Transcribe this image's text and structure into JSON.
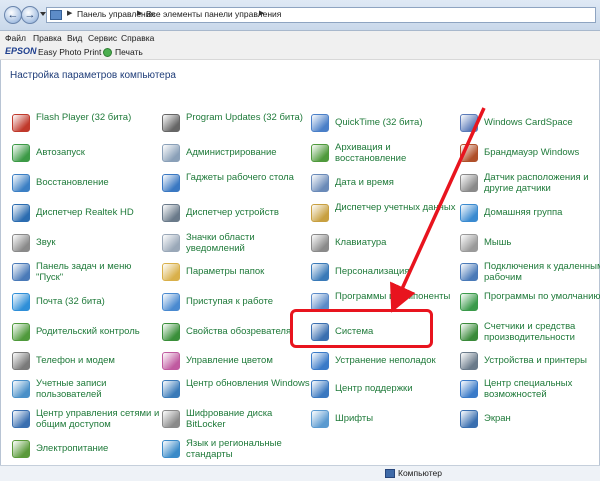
{
  "breadcrumb": [
    "Панель управления",
    "Все элементы панели управления"
  ],
  "menu": [
    "Файл",
    "Правка",
    "Вид",
    "Сервис",
    "Справка"
  ],
  "toolbar": {
    "brand": "EPSON",
    "photo_print": "Easy Photo Print",
    "print": "Печать"
  },
  "heading": "Настройка параметров компьютера",
  "columns": [
    [
      {
        "label": "Flash Player (32 бита)",
        "icon": "flash-icon",
        "color": "#c0392b"
      },
      {
        "label": "Автозапуск",
        "icon": "autoplay-icon",
        "color": "#3c9a46"
      },
      {
        "label": "Восстановление",
        "icon": "recovery-icon",
        "color": "#3b7fc4"
      },
      {
        "label": "Диспетчер Realtek HD",
        "icon": "realtek-icon",
        "color": "#2b6cb0"
      },
      {
        "label": "Звук",
        "icon": "sound-icon",
        "color": "#8a8a8a"
      },
      {
        "label": "Панель задач и меню \"Пуск\"",
        "icon": "taskbar-icon",
        "color": "#4a7ab8"
      },
      {
        "label": "Почта (32 бита)",
        "icon": "mail-icon",
        "color": "#2f8fd8"
      },
      {
        "label": "Родительский контроль",
        "icon": "parental-icon",
        "color": "#4f9a3c"
      },
      {
        "label": "Телефон и модем",
        "icon": "phone-icon",
        "color": "#7a7a7a"
      },
      {
        "label": "Учетные записи пользователей",
        "icon": "users-icon",
        "color": "#4a90c8"
      },
      {
        "label": "Центр управления сетями и общим доступом",
        "icon": "network-icon",
        "color": "#3a6fb0"
      },
      {
        "label": "Электропитание",
        "icon": "power-icon",
        "color": "#5a9a3a"
      }
    ],
    [
      {
        "label": "Program Updates (32 бита)",
        "icon": "updates-icon",
        "color": "#666666"
      },
      {
        "label": "Администрирование",
        "icon": "admin-icon",
        "color": "#8aa0b8"
      },
      {
        "label": "Гаджеты рабочего стола",
        "icon": "gadgets-icon",
        "color": "#3a78c2"
      },
      {
        "label": "Диспетчер устройств",
        "icon": "devmgr-icon",
        "color": "#6a7a8a"
      },
      {
        "label": "Значки области уведомлений",
        "icon": "tray-icon",
        "color": "#9aa8b8"
      },
      {
        "label": "Параметры папок",
        "icon": "folder-options-icon",
        "color": "#d9b04a"
      },
      {
        "label": "Приступая к работе",
        "icon": "getting-started-icon",
        "color": "#4a8ad0"
      },
      {
        "label": "Свойства обозревателя",
        "icon": "ie-icon",
        "color": "#3a8f3a"
      },
      {
        "label": "Управление цветом",
        "icon": "color-icon",
        "color": "#c05aa0"
      },
      {
        "label": "Центр обновления Windows",
        "icon": "windows-update-icon",
        "color": "#3a7ab8"
      },
      {
        "label": "Шифрование диска BitLocker",
        "icon": "bitlocker-icon",
        "color": "#8a8a8a"
      },
      {
        "label": "Язык и региональные стандарты",
        "icon": "region-icon",
        "color": "#3a8ac8"
      }
    ],
    [
      {
        "label": "QuickTime (32 бита)",
        "icon": "quicktime-icon",
        "color": "#4a7fc8"
      },
      {
        "label": "Архивация и восстановление",
        "icon": "backup-icon",
        "color": "#4f9a3c"
      },
      {
        "label": "Дата и время",
        "icon": "datetime-icon",
        "color": "#6a8ab8"
      },
      {
        "label": "Диспетчер учетных данных",
        "icon": "credentials-icon",
        "color": "#c8a040"
      },
      {
        "label": "Клавиатура",
        "icon": "keyboard-icon",
        "color": "#8a8a8a"
      },
      {
        "label": "Персонализация",
        "icon": "personalization-icon",
        "color": "#3a7ab8"
      },
      {
        "label": "Программы и компоненты",
        "icon": "programs-icon",
        "color": "#5a8ac8"
      },
      {
        "label": "Система",
        "icon": "system-icon",
        "color": "#3a6fb0"
      },
      {
        "label": "Устранение неполадок",
        "icon": "troubleshoot-icon",
        "color": "#3a7ac8"
      },
      {
        "label": "Центр поддержки",
        "icon": "action-center-icon",
        "color": "#3a78c0"
      },
      {
        "label": "Шрифты",
        "icon": "fonts-icon",
        "color": "#5a9ad0"
      }
    ],
    [
      {
        "label": "Windows CardSpace",
        "icon": "cardspace-icon",
        "color": "#5a7ab8"
      },
      {
        "label": "Брандмауэр Windows",
        "icon": "firewall-icon",
        "color": "#b0502a"
      },
      {
        "label": "Датчик расположения и другие датчики",
        "icon": "sensor-icon",
        "color": "#8a8a8a"
      },
      {
        "label": "Домашняя группа",
        "icon": "homegroup-icon",
        "color": "#3a8ad0"
      },
      {
        "label": "Мышь",
        "icon": "mouse-icon",
        "color": "#9a9a9a"
      },
      {
        "label": "Подключения к удаленным рабочим",
        "icon": "remote-icon",
        "color": "#4a7ab8"
      },
      {
        "label": "Программы по умолчанию",
        "icon": "default-programs-icon",
        "color": "#3a9a4a"
      },
      {
        "label": "Счетчики и средства производительности",
        "icon": "performance-icon",
        "color": "#3a8a3a"
      },
      {
        "label": "Устройства и принтеры",
        "icon": "printers-icon",
        "color": "#6a7a8a"
      },
      {
        "label": "Центр специальных возможностей",
        "icon": "accessibility-icon",
        "color": "#3a7ac8"
      },
      {
        "label": "Экран",
        "icon": "display-icon",
        "color": "#3a6fb0"
      }
    ]
  ],
  "statusbar": {
    "label": "Компьютер"
  },
  "colors": {
    "highlight": "#e8141e",
    "link": "#1f7a3a"
  }
}
